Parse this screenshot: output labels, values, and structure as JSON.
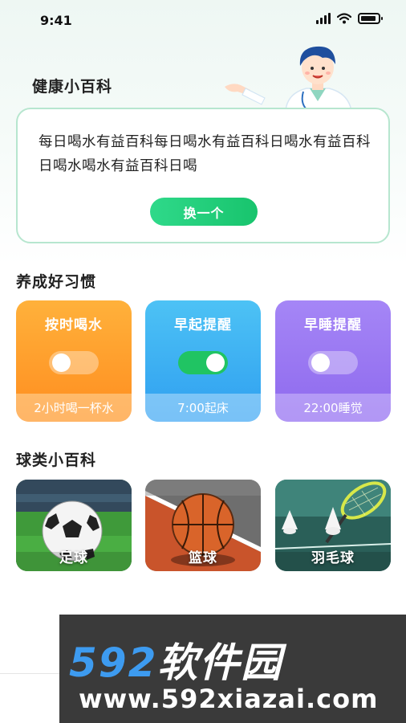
{
  "status_bar": {
    "time": "9:41"
  },
  "health": {
    "title": "健康小百科",
    "tip": "每日喝水有益百科每日喝水有益百科日喝水有益百科日喝水喝水有益百科日喝",
    "swap_button": "换一个"
  },
  "habits": {
    "title": "养成好习惯",
    "items": [
      {
        "title": "按时喝水",
        "subtitle": "2小时喝一杯水",
        "enabled": false
      },
      {
        "title": "早起提醒",
        "subtitle": "7:00起床",
        "enabled": true
      },
      {
        "title": "早睡提醒",
        "subtitle": "22:00睡觉",
        "enabled": false
      }
    ]
  },
  "balls": {
    "title": "球类小百科",
    "items": [
      {
        "label": "足球"
      },
      {
        "label": "篮球"
      },
      {
        "label": "羽毛球"
      }
    ]
  },
  "watermark": {
    "brand_number": "592",
    "brand_text": "软件园",
    "url": "www.592xiazai.com"
  },
  "colors": {
    "accent_green": "#1fc86f",
    "water_orange": "#ff9a2a",
    "early_blue": "#3aaef3",
    "sleep_purple": "#9875f2"
  }
}
